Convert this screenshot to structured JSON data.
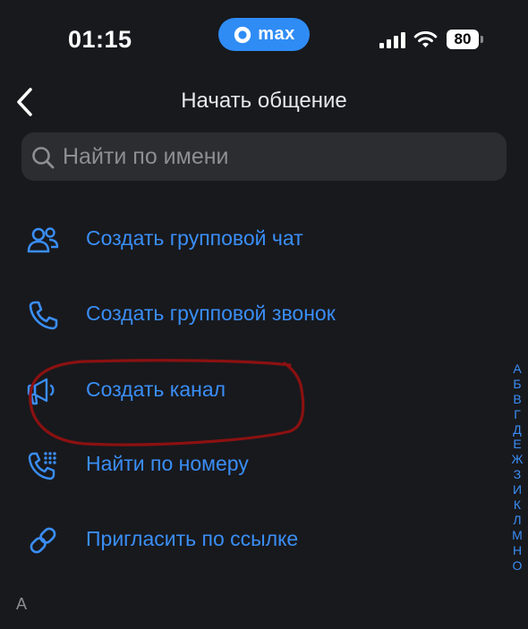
{
  "status_bar": {
    "time": "01:15",
    "app_badge": {
      "icon": "max-logo-icon",
      "label": "max"
    },
    "signal_icon": "cellular-signal-icon",
    "wifi_icon": "wifi-icon",
    "battery_level": "80"
  },
  "nav": {
    "back_icon": "chevron-left-icon",
    "title": "Начать общение"
  },
  "search": {
    "icon": "search-icon",
    "placeholder": "Найти по имени",
    "value": ""
  },
  "actions": [
    {
      "icon": "group-users-icon",
      "label": "Создать групповой чат"
    },
    {
      "icon": "phone-icon",
      "label": "Создать групповой звонок"
    },
    {
      "icon": "megaphone-icon",
      "label": "Создать канал",
      "highlighted": true
    },
    {
      "icon": "phone-keypad-icon",
      "label": "Найти по номеру"
    },
    {
      "icon": "link-icon",
      "label": "Пригласить по ссылке"
    }
  ],
  "section_header": "А",
  "alphabet_index": [
    "А",
    "Б",
    "В",
    "Г",
    "Д",
    "Е",
    "Ж",
    "З",
    "И",
    "К",
    "Л",
    "М",
    "Н",
    "О"
  ],
  "colors": {
    "background": "#18191d",
    "accent": "#3a8ef6",
    "badge": "#2f8cf5",
    "search_bg": "#2c2d31",
    "annotation": "#8b1111"
  }
}
